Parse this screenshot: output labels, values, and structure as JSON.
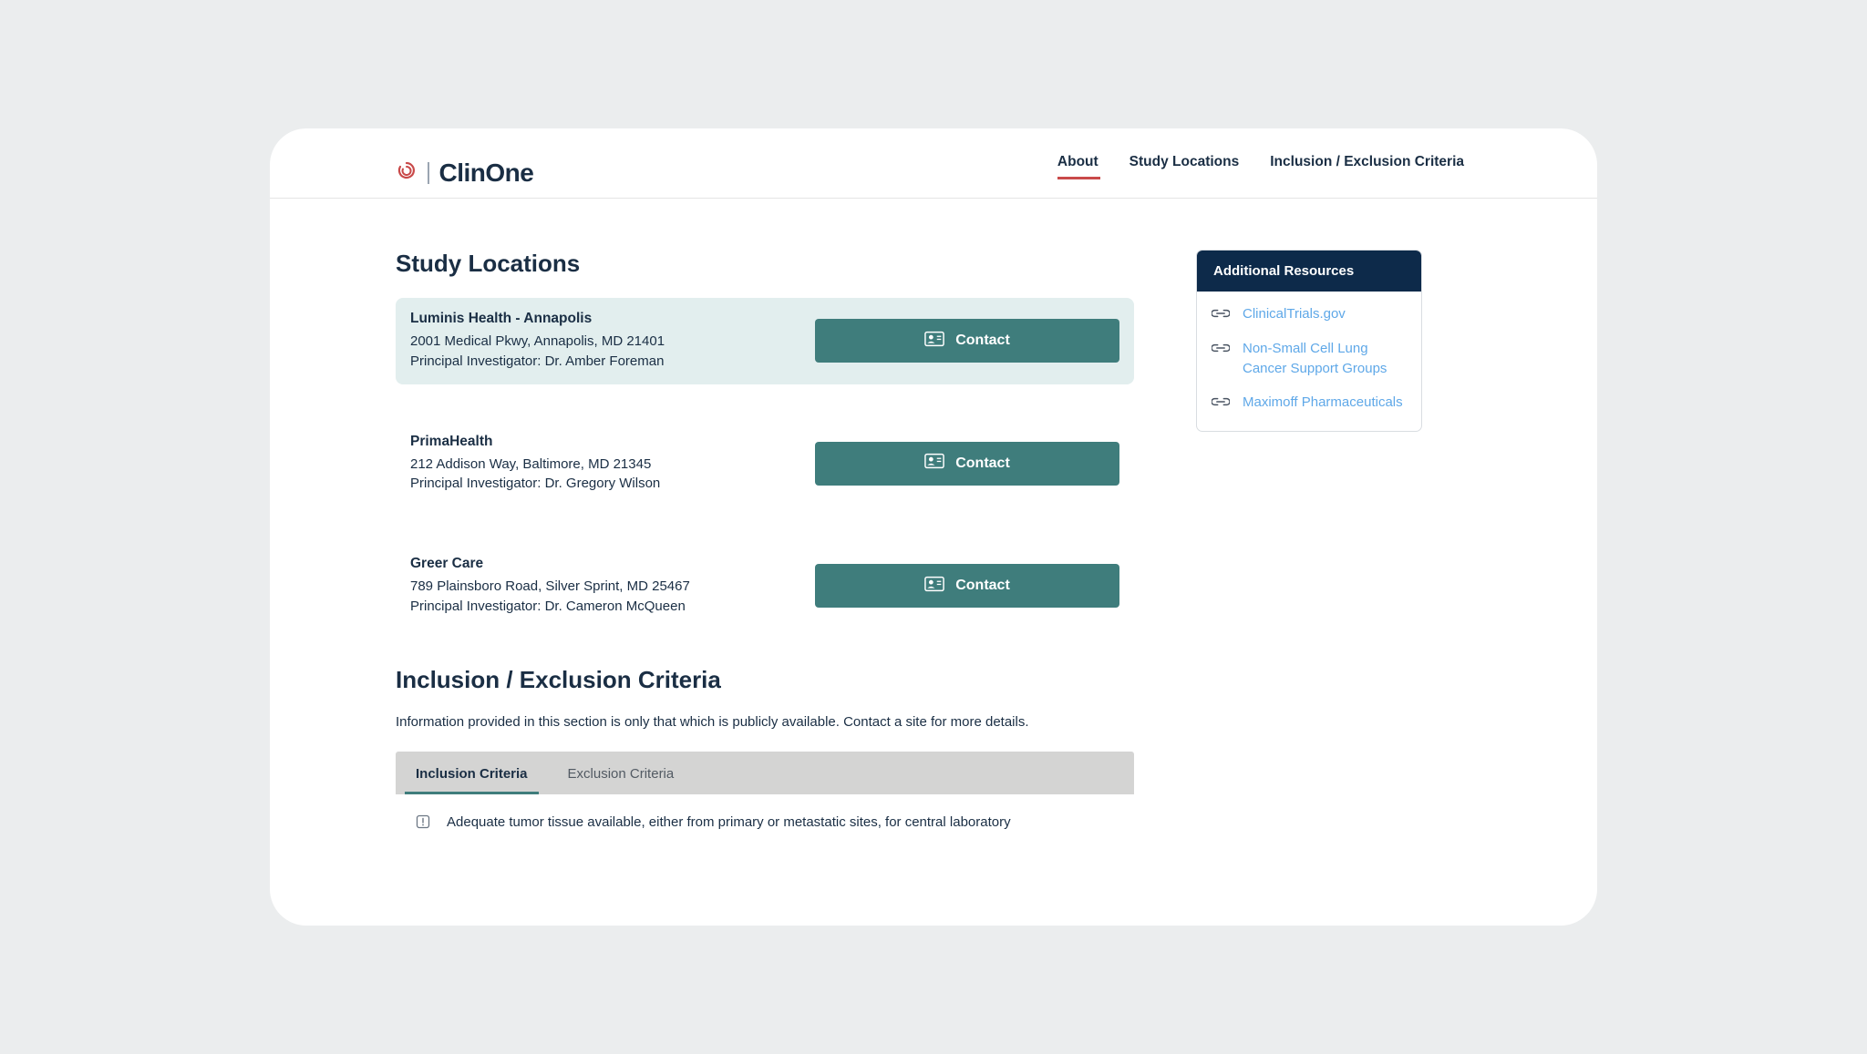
{
  "brand": "ClinOne",
  "nav": {
    "items": [
      {
        "label": "About",
        "active": true
      },
      {
        "label": "Study Locations",
        "active": false
      },
      {
        "label": "Inclusion / Exclusion Criteria",
        "active": false
      }
    ]
  },
  "sections": {
    "studyLocations": {
      "title": "Study Locations",
      "contactLabel": "Contact",
      "locations": [
        {
          "name": "Luminis Health - Annapolis",
          "address": "2001 Medical Pkwy, Annapolis, MD 21401",
          "pi": "Principal Investigator: Dr. Amber Foreman",
          "highlighted": true
        },
        {
          "name": "PrimaHealth",
          "address": "212 Addison Way, Baltimore, MD 21345",
          "pi": "Principal Investigator: Dr. Gregory Wilson",
          "highlighted": false
        },
        {
          "name": "Greer Care",
          "address": "789 Plainsboro Road, Silver Sprint, MD 25467",
          "pi": "Principal Investigator: Dr. Cameron McQueen",
          "highlighted": false
        }
      ]
    },
    "criteria": {
      "title": "Inclusion / Exclusion Criteria",
      "subtitle": "Information provided in this section is only that which is publicly available. Contact a site for more details.",
      "tabs": [
        {
          "label": "Inclusion Criteria",
          "active": true
        },
        {
          "label": "Exclusion Criteria",
          "active": false
        }
      ],
      "firstItem": "Adequate tumor tissue available, either from primary or metastatic sites, for central laboratory"
    }
  },
  "resources": {
    "title": "Additional Resources",
    "items": [
      {
        "label": "ClinicalTrials.gov"
      },
      {
        "label": "Non-Small Cell Lung Cancer Support Groups"
      },
      {
        "label": "Maximoff Pharmaceuticals"
      }
    ]
  }
}
